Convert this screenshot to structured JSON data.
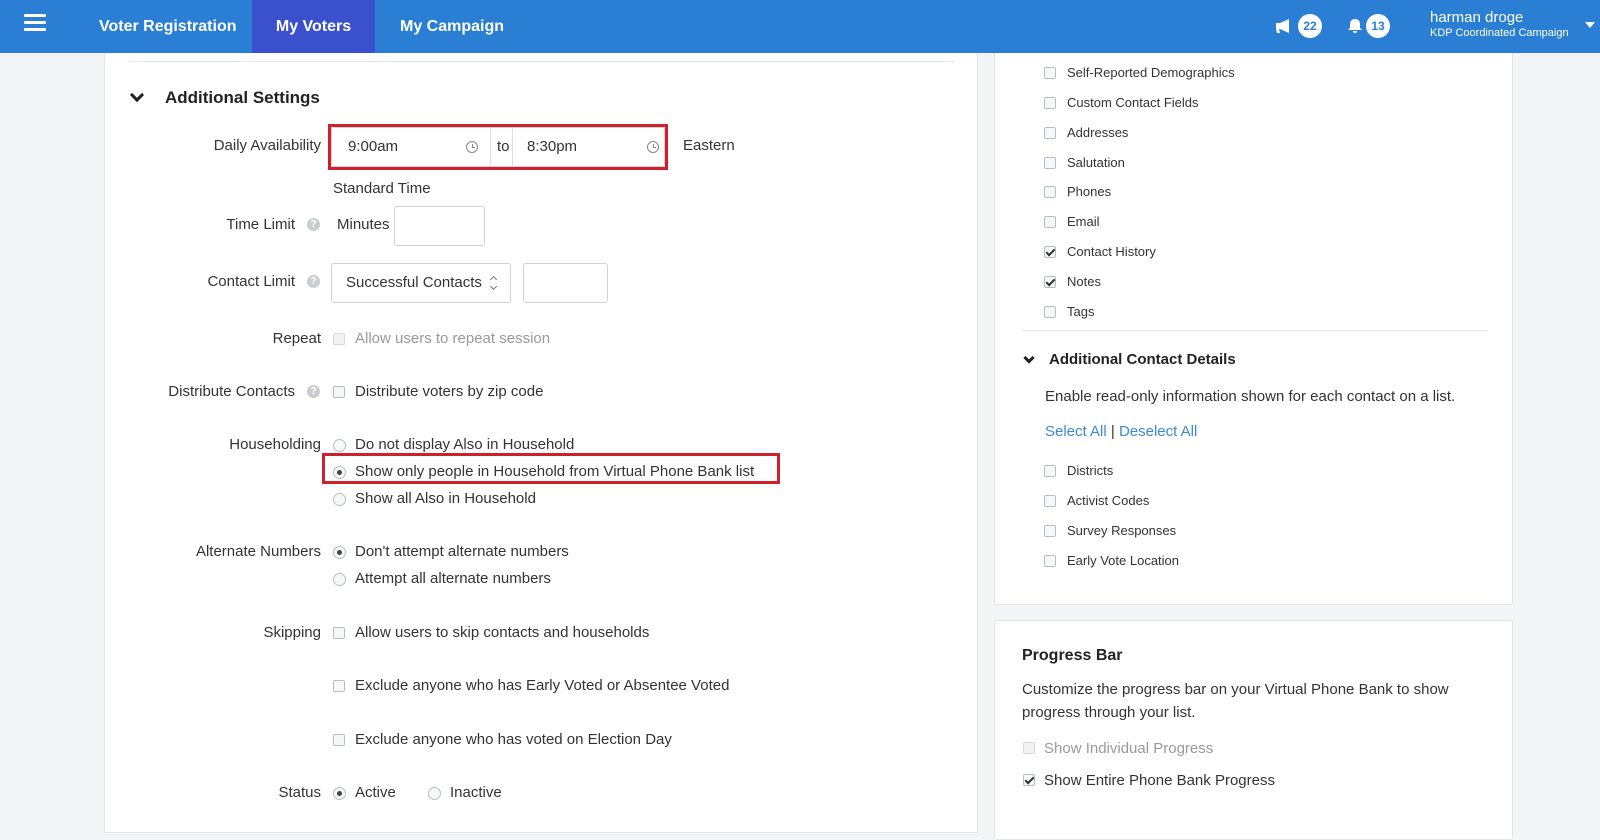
{
  "nav": {
    "items": [
      "Voter Registration",
      "My Voters",
      "My Campaign"
    ],
    "active": "My Voters",
    "announcements_count": "22",
    "notifications_count": "13",
    "user_name": "harman droge",
    "user_campaign": "KDP Coordinated Campaign"
  },
  "additional_settings": {
    "title": "Additional Settings",
    "daily_availability": {
      "label": "Daily Availability",
      "start": "9:00am",
      "to": "to",
      "end": "8:30pm",
      "tz_line1": "Eastern",
      "tz_line2": "Standard Time"
    },
    "time_limit": {
      "label": "Time Limit",
      "unit": "Minutes",
      "value": ""
    },
    "contact_limit": {
      "label": "Contact Limit",
      "selected": "Successful Contacts",
      "value": ""
    },
    "repeat": {
      "label": "Repeat",
      "option": "Allow users to repeat session"
    },
    "distribute": {
      "label": "Distribute Contacts",
      "option": "Distribute voters by zip code"
    },
    "householding": {
      "label": "Householding",
      "options": [
        "Do not display Also in Household",
        "Show only people in Household from Virtual Phone Bank list",
        "Show all Also in Household"
      ],
      "selected_index": 1
    },
    "alternate_numbers": {
      "label": "Alternate Numbers",
      "options": [
        "Don't attempt alternate numbers",
        "Attempt all alternate numbers"
      ],
      "selected_index": 0
    },
    "skipping": {
      "label": "Skipping",
      "options": [
        "Allow users to skip contacts and households",
        "Exclude anyone who has Early Voted or Absentee Voted",
        "Exclude anyone who has voted on Election Day"
      ]
    },
    "status": {
      "label": "Status",
      "options": [
        "Active",
        "Inactive"
      ],
      "selected_index": 0
    }
  },
  "contact_fields": {
    "items": [
      {
        "label": "Self-Reported Demographics",
        "checked": false
      },
      {
        "label": "Custom Contact Fields",
        "checked": false
      },
      {
        "label": "Addresses",
        "checked": false
      },
      {
        "label": "Salutation",
        "checked": false
      },
      {
        "label": "Phones",
        "checked": false
      },
      {
        "label": "Email",
        "checked": false
      },
      {
        "label": "Contact History",
        "checked": true
      },
      {
        "label": "Notes",
        "checked": true
      },
      {
        "label": "Tags",
        "checked": false
      }
    ]
  },
  "additional_contact_details": {
    "title": "Additional Contact Details",
    "description": "Enable read-only information shown for each contact on a list.",
    "select_all": "Select All",
    "separator": "|",
    "deselect_all": "Deselect All",
    "items": [
      {
        "label": "Districts",
        "checked": false
      },
      {
        "label": "Activist Codes",
        "checked": false
      },
      {
        "label": "Survey Responses",
        "checked": false
      },
      {
        "label": "Early Vote Location",
        "checked": false
      }
    ]
  },
  "progress_bar": {
    "title": "Progress Bar",
    "description_line1": "Customize the progress bar on your Virtual Phone Bank to show",
    "description_line2": "progress through your list.",
    "options": [
      {
        "label": "Show Individual Progress",
        "checked": false,
        "disabled": true
      },
      {
        "label": "Show Entire Phone Bank Progress",
        "checked": true,
        "disabled": false
      }
    ]
  }
}
